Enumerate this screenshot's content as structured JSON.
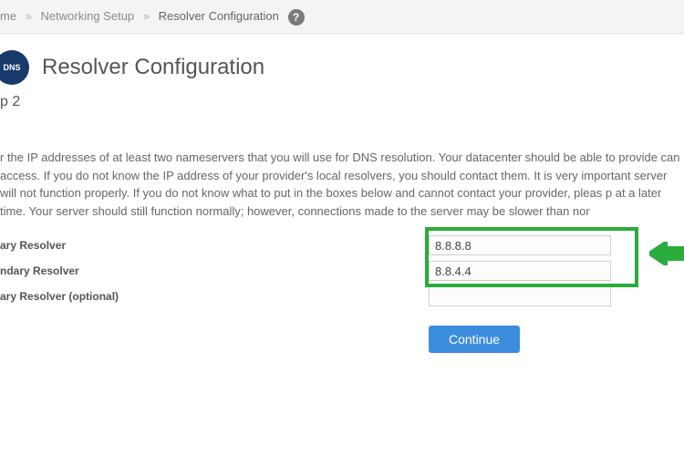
{
  "breadcrumb": [
    "me",
    "Networking Setup",
    "Resolver Configuration"
  ],
  "icons": {
    "help": "?",
    "dns": "DNS"
  },
  "title": "Resolver Configuration",
  "step_label": "p 2",
  "instructions": "r the IP addresses of at least two nameservers that you will use for DNS resolution. Your datacenter should be able to provide can access. If you do not know the IP address of your provider's local resolvers, you should contact them. It is very important server will not function properly. If you do not know what to put in the boxes below and cannot contact your provider, pleas p at a later time. Your server should still function normally; however, connections made to the server may be slower than nor",
  "form": {
    "primary": {
      "label": "ary Resolver",
      "value": "8.8.8.8"
    },
    "secondary": {
      "label": "ndary Resolver",
      "value": "8.8.4.4"
    },
    "tertiary": {
      "label": "ary Resolver (optional)",
      "value": ""
    }
  },
  "buttons": {
    "continue": "Continue"
  }
}
